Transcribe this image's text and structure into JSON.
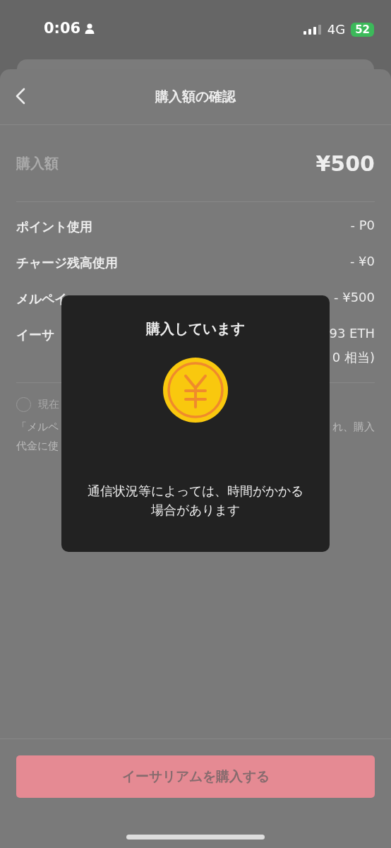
{
  "status_bar": {
    "time": "0:06",
    "network": "4G",
    "battery": "52"
  },
  "header": {
    "title": "購入額の確認"
  },
  "amount": {
    "label": "購入額",
    "value": "¥500"
  },
  "breakdown": [
    {
      "label": "ポイント使用",
      "lines": [
        "- P0"
      ]
    },
    {
      "label": "チャージ残高使用",
      "lines": [
        "- ¥0"
      ]
    },
    {
      "label": "メルペイ",
      "lines": [
        "- ¥500"
      ]
    },
    {
      "label": "イーサ",
      "lines": [
        "93 ETH",
        "0 相当)"
      ]
    }
  ],
  "option": {
    "label": "現在",
    "checked": false
  },
  "note": [
    {
      "left": "「メルペ",
      "right": "れ、購入"
    },
    {
      "left": "代金に使"
    }
  ],
  "modal": {
    "title": "購入しています",
    "message": "通信状況等によっては、時間がかかる場合があります"
  },
  "action": {
    "label": "イーサリアムを購入する"
  }
}
